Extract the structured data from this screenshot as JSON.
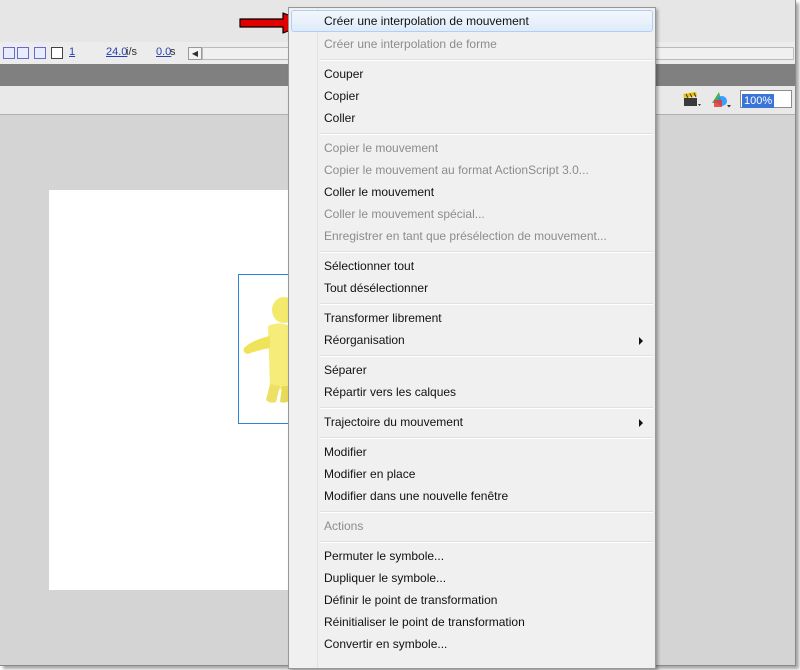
{
  "timeline": {
    "frame_number": "1",
    "fps_value": "24.0",
    "fps_unit": "i/s",
    "time_value": "0.0",
    "time_unit": "s"
  },
  "editbar": {
    "zoom_value": "100%"
  },
  "context_menu": {
    "create_motion_tween": "Créer une interpolation de mouvement",
    "create_shape_tween": "Créer une interpolation de forme",
    "cut": "Couper",
    "copy": "Copier",
    "paste": "Coller",
    "copy_motion": "Copier le mouvement",
    "copy_motion_as3": "Copier le mouvement au format ActionScript 3.0...",
    "paste_motion": "Coller le mouvement",
    "paste_motion_special": "Coller le mouvement spécial...",
    "save_motion_preset": "Enregistrer en tant que présélection de mouvement...",
    "select_all": "Sélectionner tout",
    "deselect_all": "Tout désélectionner",
    "free_transform": "Transformer librement",
    "arrange": "Réorganisation",
    "break_apart": "Séparer",
    "distribute_to_layers": "Répartir vers les calques",
    "motion_path": "Trajectoire du mouvement",
    "edit": "Modifier",
    "edit_in_place": "Modifier en place",
    "edit_in_new_window": "Modifier dans une nouvelle fenêtre",
    "actions": "Actions",
    "swap_symbol": "Permuter le symbole...",
    "duplicate_symbol": "Dupliquer le symbole...",
    "set_transform_point": "Définir le point de transformation",
    "reset_transform_point": "Réinitialiser le point de transformation",
    "convert_to_symbol": "Convertir en symbole..."
  },
  "colors": {
    "highlight_border": "#aecff7",
    "arrow": "#e00000",
    "selection": "#2a86d4",
    "zoom_selection": "#3a74d8"
  }
}
